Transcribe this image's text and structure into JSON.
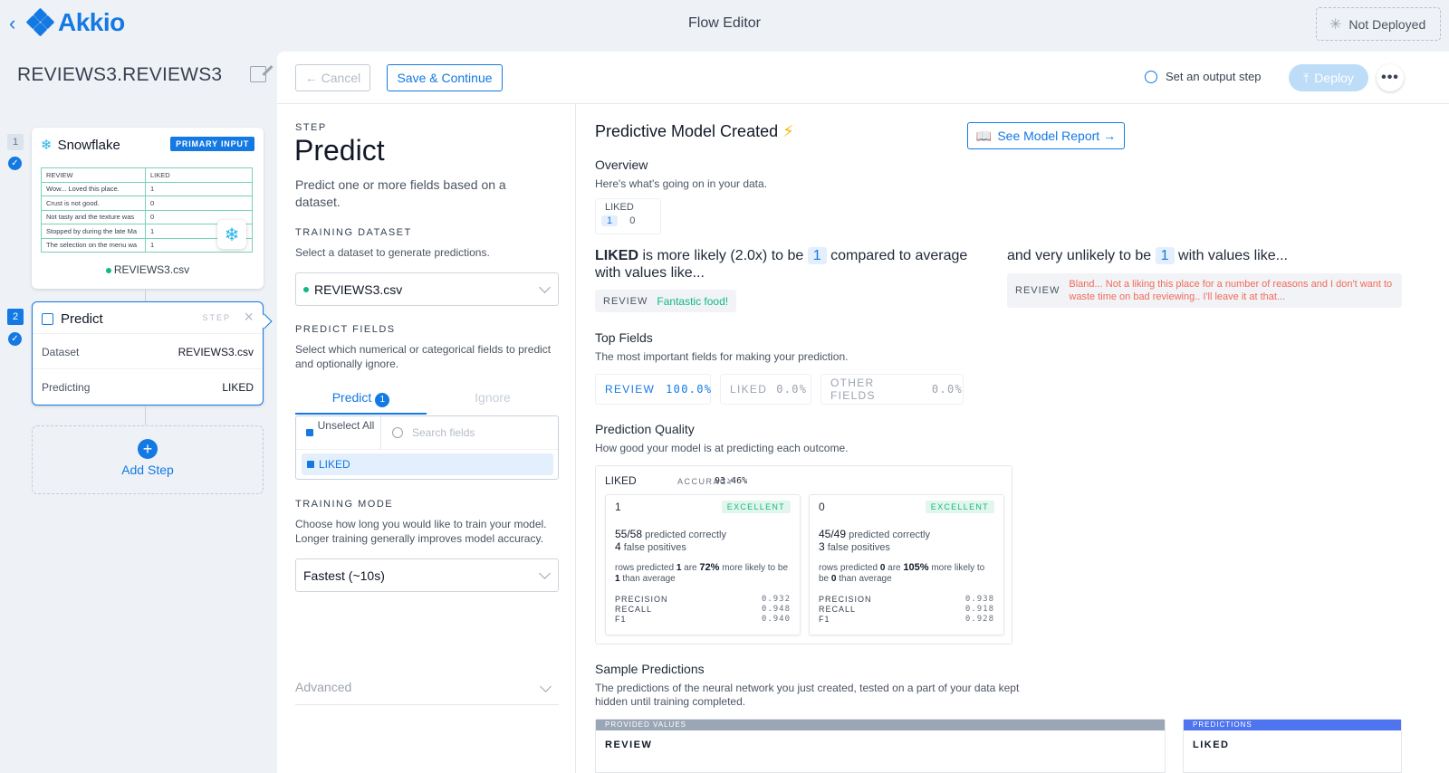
{
  "header": {
    "back_glyph": "‹",
    "logo_text": "Akkio",
    "title": "Flow Editor",
    "status": "Not Deployed"
  },
  "sidebar": {
    "flow_name": "REVIEWS3.REVIEWS3",
    "steps": [
      {
        "num": "1",
        "title": "Snowflake",
        "badge": "PRIMARY INPUT",
        "table": {
          "headers": [
            "REVIEW",
            "LIKED"
          ],
          "rows": [
            [
              "Wow... Loved this place.",
              "1"
            ],
            [
              "Crust is not good.",
              "0"
            ],
            [
              "Not tasty and the texture was",
              "0"
            ],
            [
              "Stopped by during the late Ma",
              "1"
            ],
            [
              "The selection on the menu wa",
              "1"
            ]
          ]
        },
        "file": "REVIEWS3.csv"
      },
      {
        "num": "2",
        "title": "Predict",
        "tag": "STEP",
        "rows": [
          {
            "label": "Dataset",
            "value": "REVIEWS3.csv"
          },
          {
            "label": "Predicting",
            "value": "LIKED"
          }
        ]
      }
    ],
    "add_step": "Add Step"
  },
  "toolbar": {
    "cancel": "← Cancel",
    "save": "Save & Continue",
    "output_step": "Set an output step",
    "deploy": "Deploy",
    "more": "•••"
  },
  "config": {
    "step_label": "STEP",
    "title": "Predict",
    "description": "Predict one or more fields based on a dataset.",
    "training_dataset": {
      "label": "TRAINING DATASET",
      "desc": "Select a dataset to generate predictions.",
      "value": "REVIEWS3.csv"
    },
    "predict_fields": {
      "label": "PREDICT FIELDS",
      "desc": "Select which numerical or categorical fields to predict and optionally ignore.",
      "tab_predict": "Predict",
      "tab_predict_count": "1",
      "tab_ignore": "Ignore",
      "unselect_all": "Unselect All",
      "search_placeholder": "Search fields",
      "selected_field": "LIKED"
    },
    "training_mode": {
      "label": "TRAINING MODE",
      "desc": "Choose how long you would like to train your model. Longer training generally improves model accuracy.",
      "value": "Fastest (~10s)"
    },
    "advanced": "Advanced"
  },
  "results": {
    "title": "Predictive Model Created",
    "title_icon": "⚡",
    "see_report": "See Model Report →",
    "overview": {
      "title": "Overview",
      "desc": "Here's what's going on in your data.",
      "field": "LIKED",
      "values": [
        "1",
        "0"
      ]
    },
    "likely": {
      "field": "LIKED",
      "text_a": "is more likely (2.0x) to be",
      "value": "1",
      "text_b": "compared to average with values like...",
      "pill_label": "REVIEW",
      "pill_value": "Fantastic food!"
    },
    "unlikely": {
      "text_a": "and very unlikely to be",
      "value": "1",
      "text_b": "with values like...",
      "pill_label": "REVIEW",
      "pill_value": "Bland... Not a liking this place for a number of reasons and I don't want to waste time on bad reviewing.. I'll leave it at that..."
    },
    "top_fields": {
      "title": "Top Fields",
      "desc": "The most important fields for making your prediction.",
      "items": [
        {
          "name": "REVIEW",
          "pct": "100.0%"
        },
        {
          "name": "LIKED",
          "pct": "0.0%"
        },
        {
          "name": "OTHER FIELDS",
          "pct": "0.0%"
        }
      ]
    },
    "prediction_quality": {
      "title": "Prediction Quality",
      "desc": "How good your model is at predicting each outcome.",
      "field": "LIKED",
      "accuracy_label": "ACCURACY",
      "accuracy": "93.46%",
      "outcomes": [
        {
          "value": "1",
          "grade": "EXCELLENT",
          "correct": "55/58",
          "correct_text": "predicted correctly",
          "fp": "4",
          "fp_text": "false positives",
          "rows_a": "rows predicted",
          "rows_value": "1",
          "rows_b": "are",
          "pct": "72%",
          "rows_c": "more likely to be",
          "rows_d": "than average",
          "precision": "0.932",
          "recall": "0.948",
          "f1": "0.940"
        },
        {
          "value": "0",
          "grade": "EXCELLENT",
          "correct": "45/49",
          "correct_text": "predicted correctly",
          "fp": "3",
          "fp_text": "false positives",
          "rows_a": "rows predicted",
          "rows_value": "0",
          "rows_b": "are",
          "pct": "105%",
          "rows_c": "more likely to be",
          "rows_d": "than average",
          "precision": "0.938",
          "recall": "0.918",
          "f1": "0.928"
        }
      ],
      "metric_labels": [
        "PRECISION",
        "RECALL",
        "F1"
      ]
    },
    "sample_predictions": {
      "title": "Sample Predictions",
      "desc": "The predictions of the neural network you just created, tested on a part of your data kept hidden until training completed.",
      "provided_label": "PROVIDED VALUES",
      "provided_col": "REVIEW",
      "predictions_label": "PREDICTIONS",
      "predictions_col": "LIKED"
    }
  },
  "colors": {
    "accent": "#1479e3",
    "success": "#10b981",
    "negative": "#f26b5b",
    "snowflake": "#29b5e8"
  }
}
